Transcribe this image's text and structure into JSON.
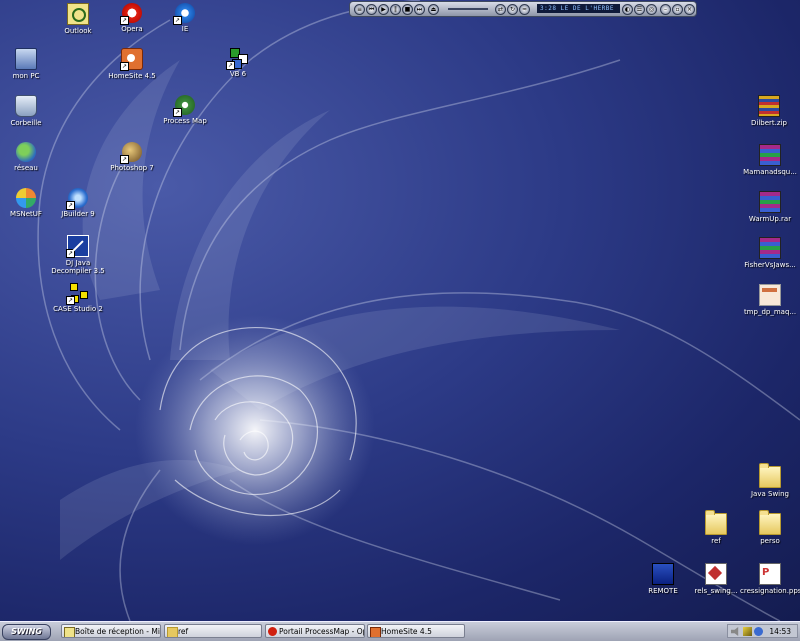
{
  "desktop": {
    "icons_left": [
      {
        "id": "outlook",
        "label": "Outlook",
        "icon": "outlook-icon",
        "shortcut": false
      },
      {
        "id": "opera",
        "label": "Opera",
        "icon": "opera-icon",
        "shortcut": true
      },
      {
        "id": "ie",
        "label": "IE",
        "icon": "internet-explorer-icon",
        "shortcut": true
      },
      {
        "id": "mon-pc",
        "label": "mon PC",
        "icon": "computer-icon",
        "shortcut": false
      },
      {
        "id": "homesite",
        "label": "HomeSite 4.5",
        "icon": "homesite-icon",
        "shortcut": true
      },
      {
        "id": "vb6",
        "label": "VB 6",
        "icon": "vb6-icon",
        "shortcut": true
      },
      {
        "id": "corbeille",
        "label": "Corbeille",
        "icon": "recycle-bin-icon",
        "shortcut": false
      },
      {
        "id": "processmap",
        "label": "Process Map",
        "icon": "process-map-icon",
        "shortcut": true
      },
      {
        "id": "reseau",
        "label": "réseau",
        "icon": "network-icon",
        "shortcut": false
      },
      {
        "id": "photoshop",
        "label": "Photoshop 7",
        "icon": "photoshop-icon",
        "shortcut": true
      },
      {
        "id": "msn",
        "label": "MSNetUF",
        "icon": "msn-icon",
        "shortcut": false
      },
      {
        "id": "jbuilder",
        "label": "JBuilder 9",
        "icon": "jbuilder-icon",
        "shortcut": true
      },
      {
        "id": "dj",
        "label": "DJ Java Decompiler 3.5",
        "label_line1": "DJ Java",
        "label_line2": "Decompiler 3.5",
        "icon": "decompiler-icon",
        "shortcut": true
      },
      {
        "id": "case",
        "label": "CASE Studio 2",
        "icon": "case-studio-icon",
        "shortcut": true
      }
    ],
    "icons_right": [
      {
        "id": "dilbert",
        "label": "Dilbert.zip",
        "icon": "zip-archive-icon"
      },
      {
        "id": "mamanadsqu",
        "label": "Mamanadsqu...",
        "icon": "rar-archive-icon"
      },
      {
        "id": "warmup",
        "label": "WarmUp.rar",
        "icon": "rar-archive-icon"
      },
      {
        "id": "fishervs",
        "label": "FisherVsJaws...",
        "icon": "rar-archive-icon"
      },
      {
        "id": "tmp",
        "label": "tmp_dp_maq...",
        "icon": "image-file-icon"
      },
      {
        "id": "javaswing",
        "label": "Java Swing",
        "icon": "folder-icon"
      },
      {
        "id": "ref",
        "label": "ref",
        "icon": "folder-icon"
      },
      {
        "id": "perso",
        "label": "perso",
        "icon": "folder-icon"
      },
      {
        "id": "remote",
        "label": "REMOTE",
        "icon": "remote-desktop-icon"
      },
      {
        "id": "rels",
        "label": "rels_swing...",
        "icon": "document-icon"
      },
      {
        "id": "pps",
        "label": "cressignation.pps",
        "icon": "powerpoint-icon"
      }
    ]
  },
  "player": {
    "display_text": "3:28  LE DE L'HERBE"
  },
  "taskbar": {
    "start_label": "SWING",
    "tasks": [
      {
        "label": "Boîte de réception - Micro...",
        "icon": "outlook-icon"
      },
      {
        "label": "ref",
        "icon": "folder-icon"
      },
      {
        "label": "Portail ProcessMap - Opera",
        "icon": "opera-icon"
      },
      {
        "label": "HomeSite 4.5",
        "icon": "homesite-icon"
      }
    ],
    "clock": "14:53"
  }
}
